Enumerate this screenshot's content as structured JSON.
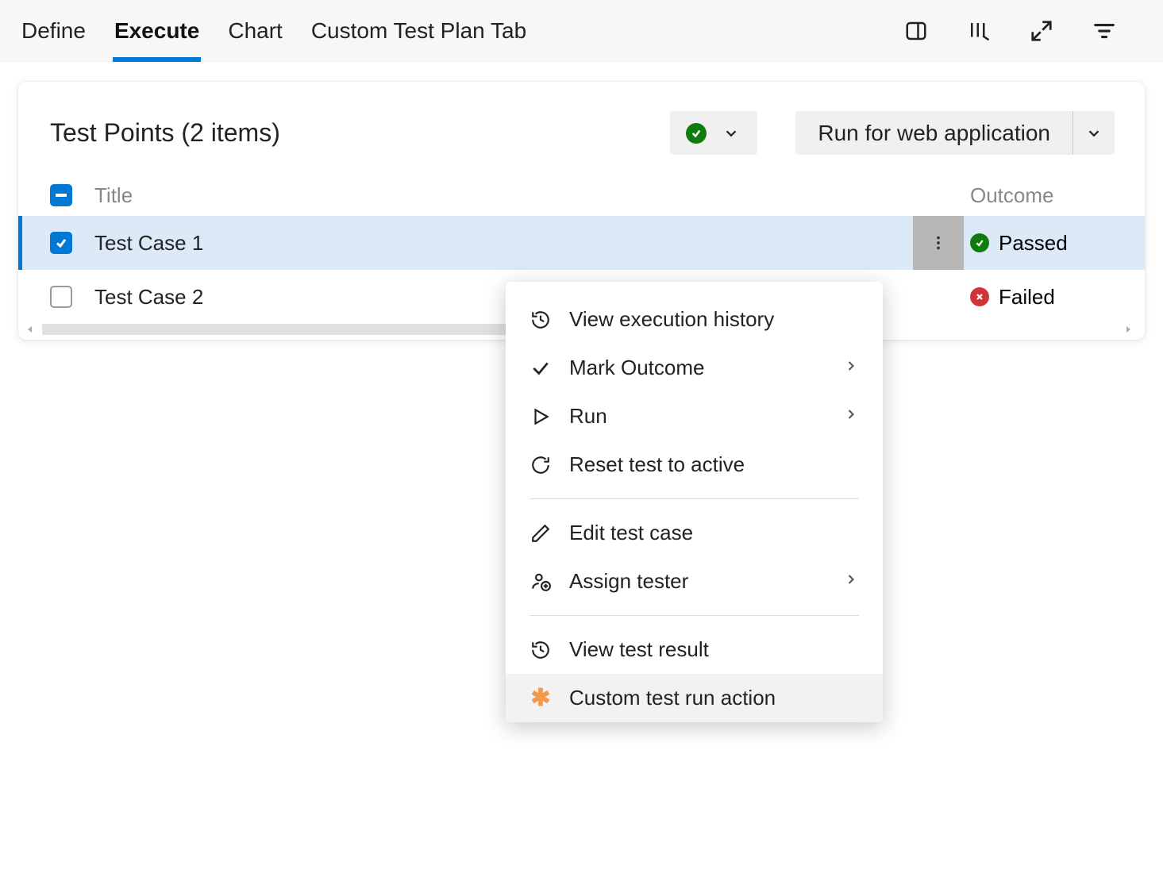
{
  "tabs": {
    "define": "Define",
    "execute": "Execute",
    "chart": "Chart",
    "custom": "Custom Test Plan Tab"
  },
  "panel": {
    "title": "Test Points (2 items)",
    "runButton": "Run for web application"
  },
  "columns": {
    "title": "Title",
    "outcome": "Outcome"
  },
  "rows": [
    {
      "title": "Test Case 1",
      "outcome": "Passed",
      "status": "passed",
      "selected": true
    },
    {
      "title": "Test Case 2",
      "outcome": "Failed",
      "status": "failed",
      "selected": false
    }
  ],
  "contextMenu": {
    "viewExecutionHistory": "View execution history",
    "markOutcome": "Mark Outcome",
    "run": "Run",
    "resetTestToActive": "Reset test to active",
    "editTestCase": "Edit test case",
    "assignTester": "Assign tester",
    "viewTestResult": "View test result",
    "customTestRunAction": "Custom test run action"
  }
}
